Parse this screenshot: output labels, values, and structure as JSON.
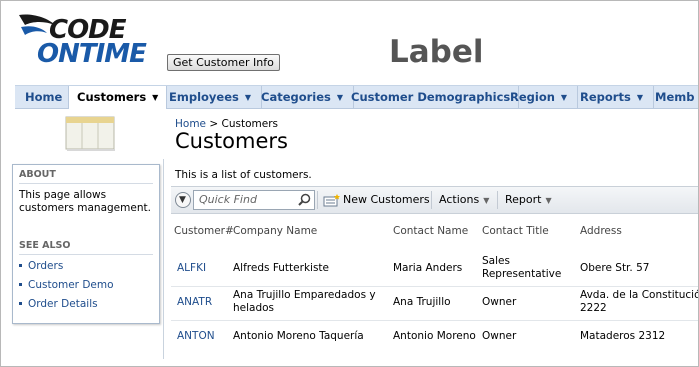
{
  "header": {
    "logo_line1": "CODE",
    "logo_line2": "ONTIME",
    "info_button": "Get Customer Info",
    "label": "Label"
  },
  "menu": [
    {
      "label": "Home",
      "dropdown": false
    },
    {
      "label": "Customers",
      "dropdown": true,
      "active": true
    },
    {
      "label": "Employees",
      "dropdown": true
    },
    {
      "label": "Categories",
      "dropdown": true
    },
    {
      "label": "Customer Demographics",
      "dropdown": false
    },
    {
      "label": "Region",
      "dropdown": true
    },
    {
      "label": "Reports",
      "dropdown": true
    },
    {
      "label": "Memb",
      "dropdown": false
    }
  ],
  "sidebar": {
    "about_title": "ABOUT",
    "about_text": "This page allows customers management.",
    "see_also_title": "SEE ALSO",
    "links": [
      "Orders",
      "Customer Demo",
      "Order Details"
    ]
  },
  "breadcrumb": {
    "home": "Home",
    "separator": ">",
    "current": "Customers"
  },
  "page": {
    "title": "Customers",
    "description": "This is a list of customers."
  },
  "toolbar": {
    "search_placeholder": "Quick Find",
    "new_label": "New Customers",
    "actions_label": "Actions",
    "report_label": "Report"
  },
  "table": {
    "columns": [
      "Customer#",
      "Company Name",
      "Contact Name",
      "Contact Title",
      "Address"
    ],
    "rows": [
      {
        "id": "ALFKI",
        "company": "Alfreds Futterkiste",
        "company_2": "",
        "contact": "Maria Anders",
        "title": "Sales",
        "title_2": "Representative",
        "address": "Obere Str. 57",
        "address_2": ""
      },
      {
        "id": "ANATR",
        "company": "Ana Trujillo Emparedados y",
        "company_2": "helados",
        "contact": "Ana Trujillo",
        "title": "Owner",
        "title_2": "",
        "address": "Avda. de la Constitución",
        "address_2": "2222"
      },
      {
        "id": "ANTON",
        "company": "Antonio Moreno Taquería",
        "company_2": "",
        "contact": "Antonio Moreno",
        "title": "Owner",
        "title_2": "",
        "address": "Mataderos 2312",
        "address_2": ""
      }
    ]
  },
  "colors": {
    "link": "#1f4d8c",
    "menubar": "#dbe6f4",
    "label_gray": "#555555"
  },
  "icons": [
    "search-icon",
    "new-record-icon",
    "chevron-down-icon",
    "page-graphic"
  ]
}
